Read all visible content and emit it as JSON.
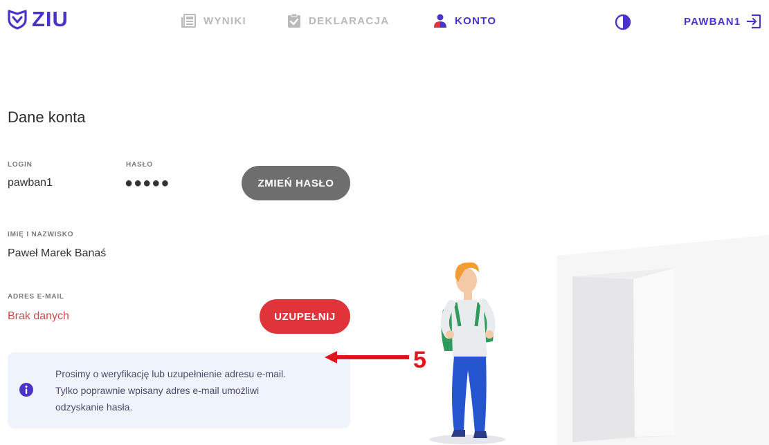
{
  "header": {
    "logo_text": "ZIU",
    "nav": [
      {
        "label": "WYNIKI",
        "icon": "newspaper-icon",
        "active": false
      },
      {
        "label": "DEKLARACJA",
        "icon": "clipboard-check-icon",
        "active": false
      },
      {
        "label": "KONTO",
        "icon": "user-icon",
        "active": true
      }
    ],
    "contrast_icon": "contrast-icon",
    "username": "PAWBAN1",
    "logout_icon": "logout-icon"
  },
  "account": {
    "title": "Dane konta",
    "login_label": "LOGIN",
    "login_value": "pawban1",
    "password_label": "HASŁO",
    "password_value": "●●●●●",
    "change_password_button": "ZMIEŃ HASŁO",
    "name_label": "IMIĘ I NAZWISKO",
    "name_value": "Paweł Marek Banaś",
    "email_label": "ADRES E-MAIL",
    "email_value": "Brak danych",
    "email_button": "UZUPEŁNIJ"
  },
  "info": {
    "lines": [
      "Prosimy o weryfikację lub uzupełnienie adresu e-mail.",
      "Tylko poprawnie wpisany adres e-mail umożliwi",
      "odzyskanie hasła."
    ]
  },
  "annotation": {
    "number": "5"
  },
  "colors": {
    "brand": "#4b33c9",
    "nav_inactive": "#b9b9b9",
    "danger": "#e0343b",
    "button_gray": "#6e6e6e",
    "info_bg": "#eff3fc",
    "annotation_red": "#e3141a"
  }
}
